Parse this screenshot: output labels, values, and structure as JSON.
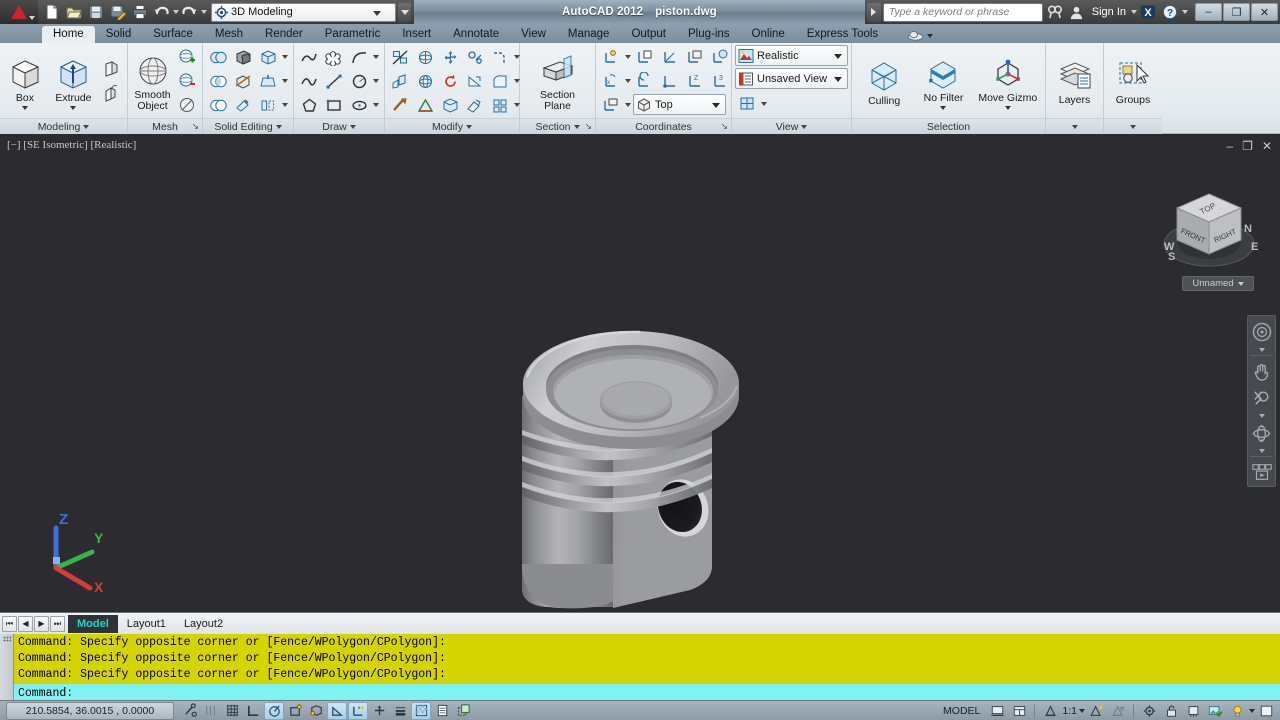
{
  "titlebar": {
    "app_icon": "autocad-logo-icon",
    "quick_access": [
      {
        "name": "new-icon",
        "label": "New"
      },
      {
        "name": "open-icon",
        "label": "Open"
      },
      {
        "name": "save-icon",
        "label": "Save"
      },
      {
        "name": "saveas-icon",
        "label": "Save As"
      },
      {
        "name": "plot-icon",
        "label": "Plot"
      },
      {
        "name": "undo-icon",
        "label": "Undo"
      },
      {
        "name": "redo-icon",
        "label": "Redo"
      }
    ],
    "workspace": "3D Modeling",
    "title": "AutoCAD 2012",
    "document": "piston.dwg",
    "search_placeholder": "Type a keyword or phrase",
    "signin": "Sign In",
    "exchange_icon": "autodesk-exchange-icon",
    "help_icon": "help-icon",
    "window_controls": {
      "minimize": "–",
      "maximize": "❐",
      "close": "✕"
    }
  },
  "ribbon": {
    "tabs": [
      {
        "label": "Home",
        "active": true
      },
      {
        "label": "Solid",
        "active": false
      },
      {
        "label": "Surface",
        "active": false
      },
      {
        "label": "Mesh",
        "active": false
      },
      {
        "label": "Render",
        "active": false
      },
      {
        "label": "Parametric",
        "active": false
      },
      {
        "label": "Insert",
        "active": false
      },
      {
        "label": "Annotate",
        "active": false
      },
      {
        "label": "View",
        "active": false
      },
      {
        "label": "Manage",
        "active": false
      },
      {
        "label": "Output",
        "active": false
      },
      {
        "label": "Plug-ins",
        "active": false
      },
      {
        "label": "Online",
        "active": false
      },
      {
        "label": "Express Tools",
        "active": false
      }
    ],
    "panels": {
      "modeling": {
        "title": "Modeling",
        "box": "Box",
        "extrude": "Extrude",
        "small_buttons": [
          "presspull-icon",
          "sweep-icon"
        ]
      },
      "mesh": {
        "title": "Mesh",
        "smooth_object_line1": "Smooth",
        "smooth_object_line2": "Object",
        "small_buttons": [
          "smooth-more-icon",
          "smooth-less-icon",
          "refine-mesh-icon"
        ]
      },
      "solid_editing": {
        "title": "Solid Editing",
        "small_buttons": [
          "union-icon",
          "subtract-icon",
          "solid-extrude-face-icon",
          "intersect-icon",
          "slice-icon",
          "taper-face-icon",
          "solid-history-icon",
          "clean-icon",
          "separate-icon"
        ]
      },
      "draw": {
        "title": "Draw",
        "small_buttons": [
          "polyline-icon",
          "revcloud-icon",
          "arc-icon",
          "spline-icon",
          "line-icon",
          "circle-icon",
          "polygon-icon",
          "rectangle-icon",
          "ellipse-icon"
        ]
      },
      "modify": {
        "title": "Modify",
        "small_buttons": [
          "trim-icon",
          "3drotate-icon",
          "3dmove-icon",
          "3dalign-icon",
          "fillet-edge-icon",
          "copy-face-icon",
          "3dscale-icon",
          "rotate-icon",
          "taper-icon",
          "extrude-face-icon",
          "shell-icon",
          "3darray-icon",
          "solid-chamfer-icon",
          "imprint-icon",
          "array-icon"
        ]
      },
      "section": {
        "title": "Section",
        "section_plane_line1": "Section",
        "section_plane_line2": "Plane"
      },
      "coordinates": {
        "title": "Coordinates",
        "ucs_view": "Top",
        "small_buttons": [
          "ucs-world-icon",
          "ucs-named-icon",
          "ucs-3point-icon",
          "ucs-face-icon",
          "ucs-object-icon",
          "ucs-x-icon",
          "ucs-previous-icon",
          "ucs-origin-icon",
          "ucs-z-icon",
          "ucs-zaxis-icon",
          "ucs-view-icon"
        ]
      },
      "view": {
        "title": "View",
        "visual_style": "Realistic",
        "named_view": "Unsaved View",
        "viewport_config_icon": "viewport-config-icon"
      },
      "selection": {
        "title": "Selection",
        "culling": "Culling",
        "no_filter": "No Filter",
        "move_gizmo": "Move Gizmo"
      },
      "layers": {
        "title": "",
        "label": "Layers"
      },
      "groups": {
        "title": "",
        "label": "Groups"
      }
    }
  },
  "viewport": {
    "label": "[−] [SE Isometric] [Realistic]",
    "background_color": "#2b2b30",
    "viewcube": {
      "top_face": "TOP",
      "front_face": "FRONT",
      "right_face": "RIGHT",
      "compass": {
        "north": "N",
        "south": "S",
        "east": "E",
        "west": "W"
      }
    },
    "ucs_selector": "Unnamed",
    "ucs_icon": {
      "x_label": "X",
      "y_label": "Y",
      "z_label": "Z",
      "x_color": "#d93a3a",
      "y_color": "#35b44a",
      "z_color": "#3c6fe0"
    },
    "navbar_items": [
      "steering-wheel-icon",
      "pan-icon",
      "zoom-icon",
      "orbit-icon",
      "showmotion-icon"
    ],
    "model": {
      "name": "piston",
      "material_color": "#a8a8a8",
      "description": "3D piston solid shown in SE isometric realistic view"
    },
    "window_controls": {
      "minimize": "–",
      "restore": "❐",
      "close": "✕"
    }
  },
  "layout_tabs": {
    "nav_buttons": [
      "first-layout-button",
      "prev-layout-button",
      "next-layout-button",
      "last-layout-button"
    ],
    "tabs": [
      {
        "label": "Model",
        "active": true
      },
      {
        "label": "Layout1",
        "active": false
      },
      {
        "label": "Layout2",
        "active": false
      }
    ]
  },
  "command_line": {
    "history": [
      "Command: Specify opposite corner or [Fence/WPolygon/CPolygon]:",
      "Command: Specify opposite corner or [Fence/WPolygon/CPolygon]:",
      "Command: Specify opposite corner or [Fence/WPolygon/CPolygon]:"
    ],
    "prompt": "Command:",
    "history_bg": "#d6d400",
    "prompt_bg": "#7ff2f2"
  },
  "status_bar": {
    "coordinates": "210.5854, 36.0015 , 0.0000",
    "toggles": [
      {
        "name": "infer-constraints-toggle",
        "on": false
      },
      {
        "name": "snap-mode-toggle",
        "on": false
      },
      {
        "name": "grid-display-toggle",
        "on": false
      },
      {
        "name": "ortho-mode-toggle",
        "on": false
      },
      {
        "name": "polar-tracking-toggle",
        "on": true
      },
      {
        "name": "object-snap-toggle",
        "on": false
      },
      {
        "name": "3d-object-snap-toggle",
        "on": false
      },
      {
        "name": "object-snap-tracking-toggle",
        "on": true
      },
      {
        "name": "dynamic-ucs-toggle",
        "on": true
      },
      {
        "name": "dynamic-input-toggle",
        "on": false
      },
      {
        "name": "lineweight-toggle",
        "on": false
      },
      {
        "name": "transparency-toggle",
        "on": true
      },
      {
        "name": "quick-properties-toggle",
        "on": false
      },
      {
        "name": "selection-cycling-toggle",
        "on": false
      }
    ],
    "space_label": "MODEL",
    "annotation_scale": "1:1",
    "right_icons": [
      "model-space-icon",
      "viewport-icon",
      "annotation-visibility-icon",
      "auto-scale-icon",
      "workspace-switching-icon",
      "toolbar-lock-icon",
      "hardware-acceleration-icon",
      "isolate-objects-icon",
      "status-bar-menu-icon",
      "clean-screen-icon"
    ]
  }
}
